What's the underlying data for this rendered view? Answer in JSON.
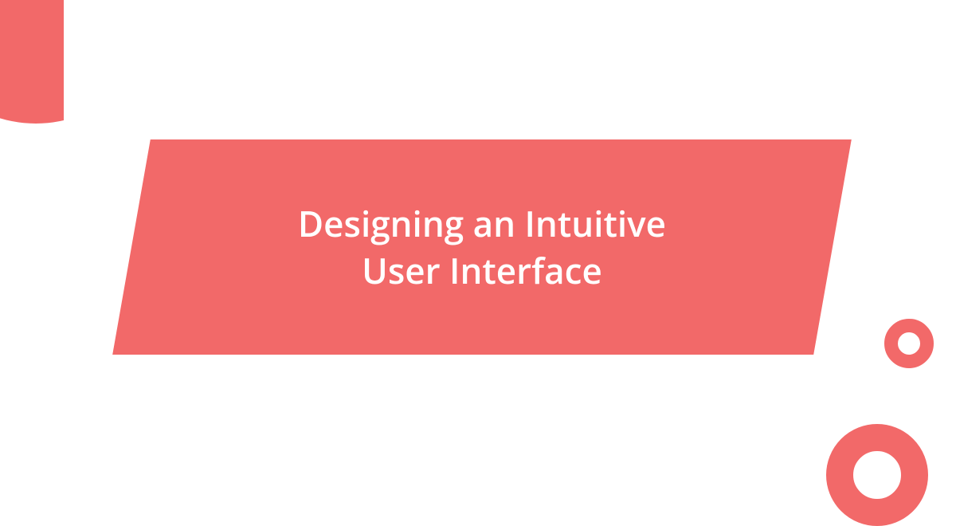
{
  "title": "Designing an Intuitive\nUser Interface",
  "colors": {
    "accent": "#f26969",
    "background": "#ffffff",
    "title_text": "#ffffff"
  }
}
